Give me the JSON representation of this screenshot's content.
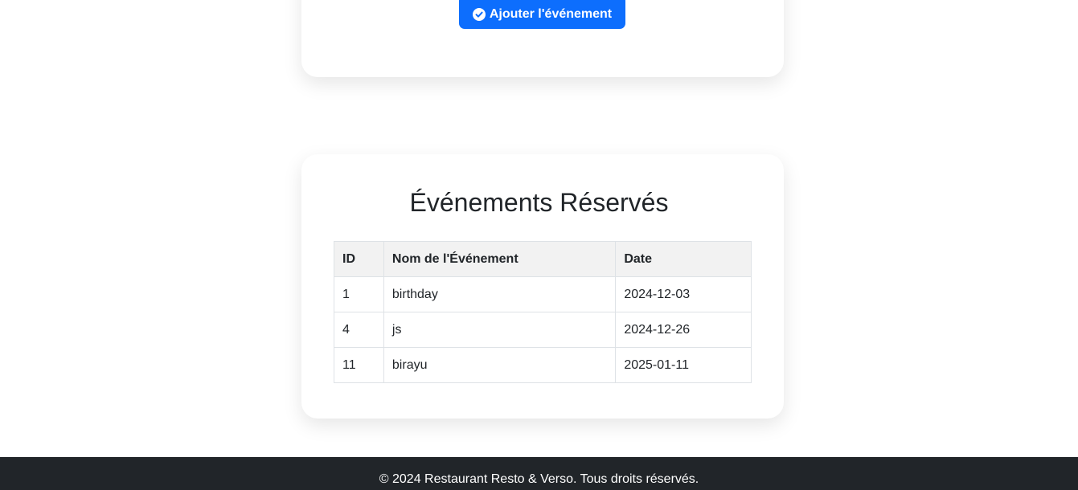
{
  "form_card": {
    "submit_label": "Ajouter l'événement",
    "submit_icon": "check-circle-icon",
    "accent_color": "#0d6efd"
  },
  "events_card": {
    "title": "Événements Réservés",
    "table": {
      "headers": [
        "ID",
        "Nom de l'Événement",
        "Date"
      ],
      "rows": [
        [
          "1",
          "birthday",
          "2024-12-03"
        ],
        [
          "4",
          "js",
          "2024-12-26"
        ],
        [
          "11",
          "birayu",
          "2025-01-11"
        ]
      ]
    }
  },
  "footer": {
    "text": "© 2024 Restaurant Resto & Verso. Tous droits réservés.",
    "background_color": "#212529"
  }
}
